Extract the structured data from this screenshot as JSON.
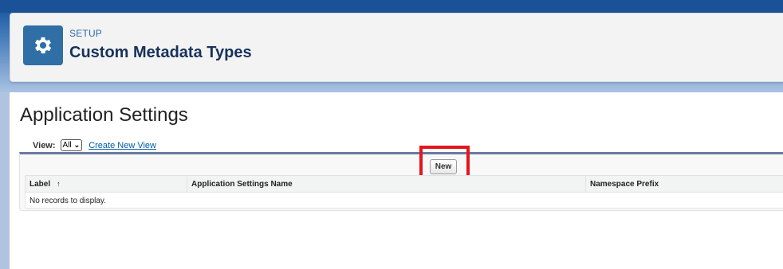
{
  "header": {
    "setup_label": "SETUP",
    "title": "Custom Metadata Types",
    "icon": "gear-icon",
    "icon_bg": "#2f6fa6"
  },
  "main": {
    "section_title": "Application Settings",
    "view": {
      "label": "View:",
      "selected": "All",
      "create_link": "Create New View"
    },
    "list": {
      "new_button": "New",
      "columns": [
        "Label",
        "Application Settings Name",
        "Namespace Prefix"
      ],
      "sort_indicator": "↑",
      "empty_message": "No records to display."
    }
  },
  "annotations": {
    "highlight_color": "#e3161d"
  }
}
